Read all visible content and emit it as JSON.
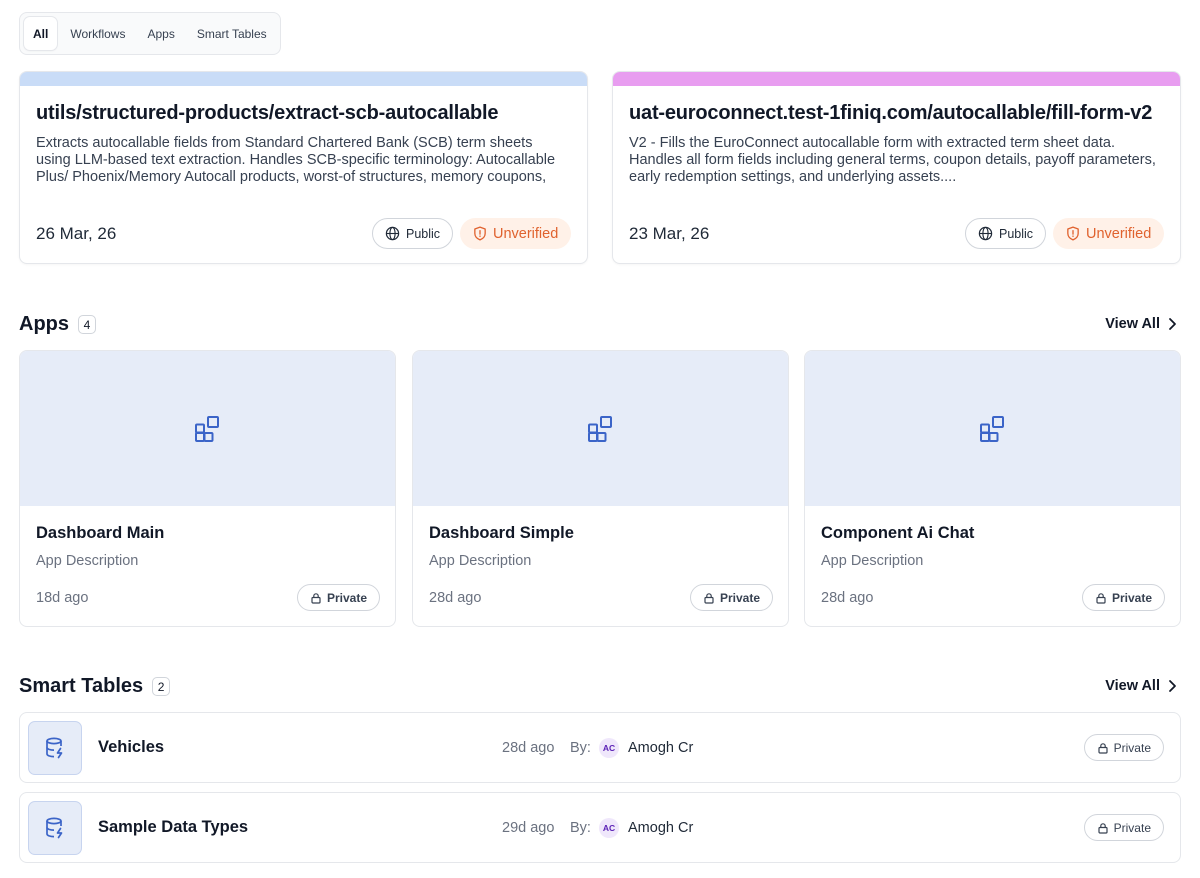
{
  "tabs": [
    {
      "label": "All",
      "active": true
    },
    {
      "label": "Workflows",
      "active": false
    },
    {
      "label": "Apps",
      "active": false
    },
    {
      "label": "Smart Tables",
      "active": false
    }
  ],
  "workflows": [
    {
      "title": "utils/structured-products/extract-scb-autocallable",
      "description": "Extracts autocallable fields from Standard Chartered Bank (SCB) term sheets using LLM-based text extraction. Handles SCB-specific terminology: Autocallable Plus/ Phoenix/Memory Autocall products, worst-of structures, memory coupons, step-down triggers.",
      "date": "26 Mar, 26",
      "visibility": "Public",
      "status": "Unverified",
      "accent": "#c9dcf7"
    },
    {
      "title": "uat-euroconnect.test-1finiq.com/autocallable/fill-form-v2",
      "description": "V2 - Fills the EuroConnect autocallable form with extracted term sheet data. Handles all form fields including general terms, coupon details, payoff parameters, early redemption settings, and underlying assets....",
      "date": "23 Mar, 26",
      "visibility": "Public",
      "status": "Unverified",
      "accent": "#e89df0"
    }
  ],
  "apps_section": {
    "title": "Apps",
    "count": "4",
    "view_all": "View All",
    "items": [
      {
        "name": "Dashboard Main",
        "description": "App Description",
        "ago": "18d ago",
        "visibility": "Private"
      },
      {
        "name": "Dashboard Simple",
        "description": "App Description",
        "ago": "28d ago",
        "visibility": "Private"
      },
      {
        "name": "Component Ai Chat",
        "description": "App Description",
        "ago": "28d ago",
        "visibility": "Private"
      }
    ]
  },
  "tables_section": {
    "title": "Smart Tables",
    "count": "2",
    "view_all": "View All",
    "items": [
      {
        "name": "Vehicles",
        "ago": "28d ago",
        "by_label": "By:",
        "owner_initials": "AC",
        "owner": "Amogh Cr",
        "visibility": "Private"
      },
      {
        "name": "Sample Data Types",
        "ago": "29d ago",
        "by_label": "By:",
        "owner_initials": "AC",
        "owner": "Amogh Cr",
        "visibility": "Private"
      }
    ]
  },
  "colors": {
    "accent_blue": "#3b64c8",
    "unverified_text": "#e0622e",
    "unverified_bg": "#fff1e8",
    "thumb_bg": "#e6ecf8"
  }
}
